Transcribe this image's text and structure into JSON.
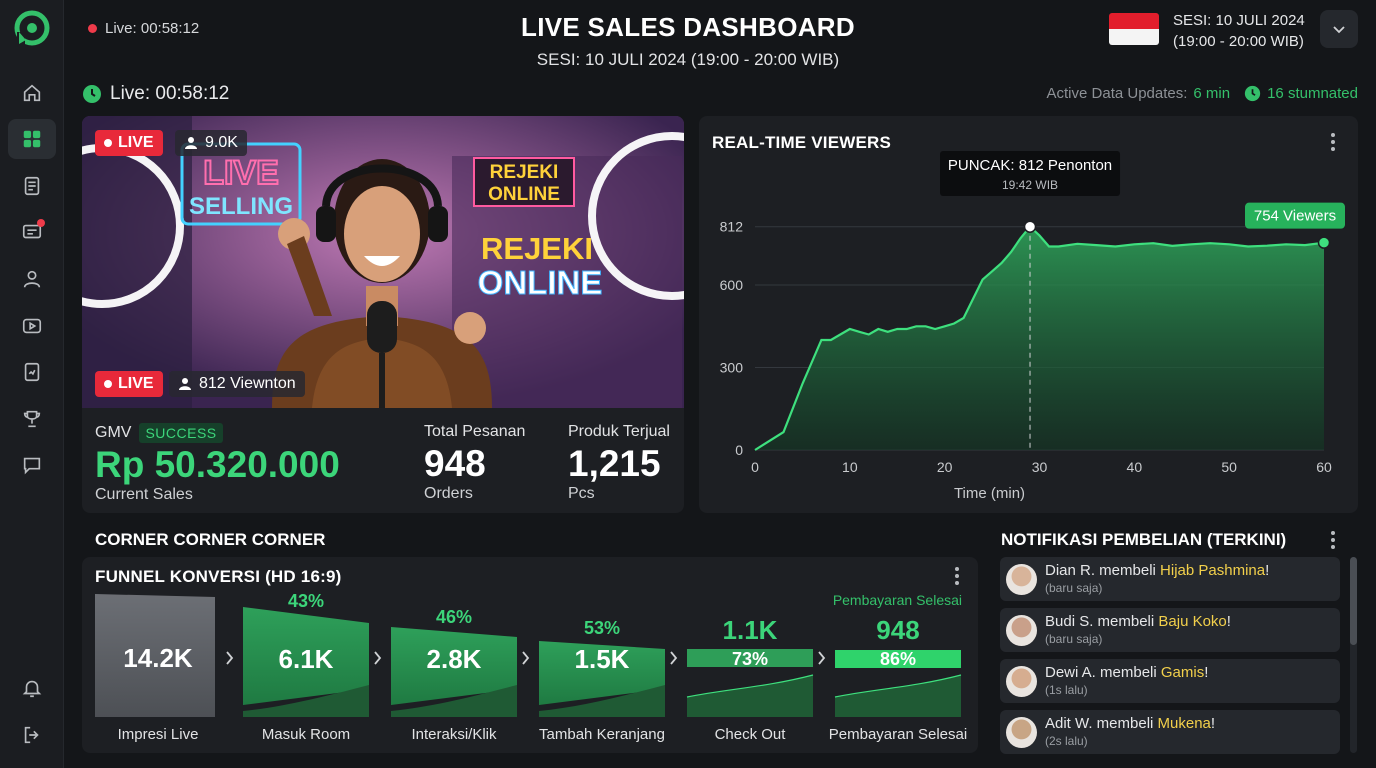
{
  "header": {
    "live_timer": "Live: 00:58:12",
    "title": "LIVE SALES DASHBOARD",
    "subtitle": "SESI: 10 JULI 2024 (19:00 - 20:00 WIB)",
    "session_date": "SESI: 10 JULI 2024",
    "session_time": "(19:00 - 20:00 WIB)",
    "sub_live_timer": "Live: 00:58:12",
    "updates_label": "Active Data Updates:",
    "updates_value": "6 min",
    "stumnated": "16 stumnated"
  },
  "colors": {
    "accent": "#34c06a",
    "live_red": "#e8293a",
    "highlight": "#f2d04b"
  },
  "sidebar": {
    "items": [
      {
        "icon": "home-icon",
        "active": false
      },
      {
        "icon": "dashboard-grid-icon",
        "active": true
      },
      {
        "icon": "document-list-icon",
        "active": false
      },
      {
        "icon": "chat-notification-icon",
        "active": false,
        "badge": true
      },
      {
        "icon": "user-icon",
        "active": false
      },
      {
        "icon": "play-video-icon",
        "active": false
      },
      {
        "icon": "report-icon",
        "active": false
      },
      {
        "icon": "trophy-icon",
        "active": false
      },
      {
        "icon": "message-icon",
        "active": false
      },
      {
        "icon": "bell-icon",
        "active": false
      },
      {
        "icon": "logout-icon",
        "active": false
      }
    ]
  },
  "video": {
    "live_label": "LIVE",
    "top_viewers": "9.0K",
    "bottom_viewers": "812 Viewnton",
    "sign_live": "LIVE",
    "sign_selling": "SELLING",
    "sign_rejeki_small_1": "REJEKI",
    "sign_rejeki_small_2": "ONLINE",
    "sign_rejeki_big_1": "REJEKI",
    "sign_rejeki_big_2": "ONLINE"
  },
  "stats": {
    "gmv_label": "GMV",
    "gmv_status": "SUCCESS",
    "gmv_value": "Rp 50.320.000",
    "gmv_caption": "Current Sales",
    "orders_label": "Total Pesanan",
    "orders_value": "948",
    "orders_caption": "Orders",
    "products_label": "Produk Terjual",
    "products_value": "1,215",
    "products_caption": "Pcs"
  },
  "chart_data": {
    "type": "area",
    "title": "REAL-TIME VIEWERS",
    "xlabel": "Time (min)",
    "ylabel": "",
    "xlim": [
      0,
      60
    ],
    "x_ticks": [
      0,
      10,
      20,
      30,
      40,
      50,
      60
    ],
    "y_ticks": [
      0,
      300,
      600,
      812
    ],
    "ylim": [
      0,
      1000
    ],
    "grid": true,
    "peak_label": "PUNCAK: 812 Penonton",
    "peak_time": "19:42 WIB",
    "peak_x": 29,
    "end_label": "754 Viewers",
    "series": [
      {
        "name": "",
        "x": [
          0,
          3,
          5,
          6,
          7,
          8,
          9,
          10,
          11,
          12,
          13,
          14,
          15,
          16,
          17,
          18,
          19,
          20,
          21,
          22,
          23,
          24,
          25,
          26,
          27,
          28,
          29,
          30,
          31,
          32,
          34,
          36,
          38,
          40,
          42,
          44,
          46,
          48,
          50,
          52,
          54,
          56,
          58,
          60
        ],
        "y": [
          0,
          65,
          240,
          320,
          400,
          400,
          420,
          440,
          430,
          420,
          440,
          430,
          440,
          440,
          450,
          450,
          440,
          450,
          460,
          480,
          550,
          620,
          650,
          680,
          720,
          770,
          812,
          780,
          740,
          740,
          750,
          745,
          740,
          748,
          752,
          742,
          748,
          752,
          748,
          740,
          743,
          748,
          745,
          754
        ]
      }
    ]
  },
  "bottom": {
    "section_title": "CORNER CORNER CORNER",
    "funnel_title": "FUNNEL KONVERSI (HD 16:9)",
    "notif_title": "NOTIFIKASI PEMBELIAN (TERKINI)"
  },
  "funnel": {
    "completed_label": "Pembayaran Selesai",
    "stages": [
      {
        "label": "Impresi Live",
        "value": "14.2K",
        "percent": ""
      },
      {
        "label": "Masuk Room",
        "value": "6.1K",
        "percent": "43%"
      },
      {
        "label": "Interaksi/Klik",
        "value": "2.8K",
        "percent": "46%"
      },
      {
        "label": "Tambah Keranjang",
        "value": "1.5K",
        "percent": "53%"
      },
      {
        "label": "Check Out",
        "value": "1.1K",
        "percent": "73%"
      },
      {
        "label": "Pembayaran Selesai",
        "value": "948",
        "percent": "86%"
      }
    ]
  },
  "notifications": [
    {
      "name": "Dian R. membeli ",
      "product": "Hijab Pashmina",
      "suffix": "!",
      "time": "(baru saja)"
    },
    {
      "name": "Budi S. membeli ",
      "product": "Baju Koko",
      "suffix": "!",
      "time": "(baru saja)"
    },
    {
      "name": "Dewi A. membeli ",
      "product": "Gamis",
      "suffix": "!",
      "time": "(1s lalu)"
    },
    {
      "name": "Adit W. membeli ",
      "product": "Mukena",
      "suffix": "!",
      "time": "(2s lalu)"
    }
  ]
}
